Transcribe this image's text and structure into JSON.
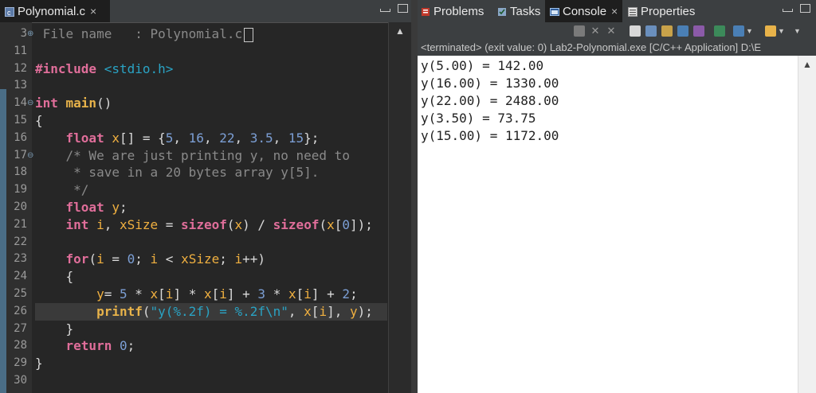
{
  "editor": {
    "tab_label": "Polynomial.c",
    "tab_close": "×",
    "line_numbers": [
      "3",
      "11",
      "12",
      "13",
      "14",
      "15",
      "16",
      "17",
      "18",
      "19",
      "20",
      "21",
      "22",
      "23",
      "24",
      "25",
      "26",
      "27",
      "28",
      "29",
      "30"
    ],
    "fold_markers": {
      "0": "⊕",
      "4": "⊖",
      "7": "⊖"
    },
    "lines": [
      [
        [
          "c-cmt",
          " File name   : Polynomial.c"
        ]
      ],
      [],
      [
        [
          "c-inc",
          "#include "
        ],
        [
          "c-hdr",
          "<stdio.h>"
        ]
      ],
      [],
      [
        [
          "c-kw",
          "int "
        ],
        [
          "c-fn",
          "main"
        ],
        [
          "c-op",
          "()"
        ]
      ],
      [
        [
          "c-op",
          "{"
        ]
      ],
      [
        [
          "c-op",
          "    "
        ],
        [
          "c-kw",
          "float "
        ],
        [
          "c-var",
          "x"
        ],
        [
          "c-op",
          "[] = {"
        ],
        [
          "c-num",
          "5"
        ],
        [
          "c-op",
          ", "
        ],
        [
          "c-num",
          "16"
        ],
        [
          "c-op",
          ", "
        ],
        [
          "c-num",
          "22"
        ],
        [
          "c-op",
          ", "
        ],
        [
          "c-num",
          "3.5"
        ],
        [
          "c-op",
          ", "
        ],
        [
          "c-num",
          "15"
        ],
        [
          "c-op",
          "};"
        ]
      ],
      [
        [
          "c-cmt",
          "    /* We are just printing y, no need to"
        ]
      ],
      [
        [
          "c-cmt",
          "     * save in a 20 bytes array y[5]."
        ]
      ],
      [
        [
          "c-cmt",
          "     */"
        ]
      ],
      [
        [
          "c-op",
          "    "
        ],
        [
          "c-kw",
          "float "
        ],
        [
          "c-var",
          "y"
        ],
        [
          "c-op",
          ";"
        ]
      ],
      [
        [
          "c-op",
          "    "
        ],
        [
          "c-kw",
          "int "
        ],
        [
          "c-var",
          "i"
        ],
        [
          "c-op",
          ", "
        ],
        [
          "c-var",
          "xSize"
        ],
        [
          "c-op",
          " = "
        ],
        [
          "c-kw",
          "sizeof"
        ],
        [
          "c-op",
          "("
        ],
        [
          "c-var",
          "x"
        ],
        [
          "c-op",
          ") / "
        ],
        [
          "c-kw",
          "sizeof"
        ],
        [
          "c-op",
          "("
        ],
        [
          "c-var",
          "x"
        ],
        [
          "c-op",
          "["
        ],
        [
          "c-num",
          "0"
        ],
        [
          "c-op",
          "]);"
        ]
      ],
      [],
      [
        [
          "c-op",
          "    "
        ],
        [
          "c-kw",
          "for"
        ],
        [
          "c-op",
          "("
        ],
        [
          "c-var",
          "i"
        ],
        [
          "c-op",
          " = "
        ],
        [
          "c-num",
          "0"
        ],
        [
          "c-op",
          "; "
        ],
        [
          "c-var",
          "i"
        ],
        [
          "c-op",
          " < "
        ],
        [
          "c-var",
          "xSize"
        ],
        [
          "c-op",
          "; "
        ],
        [
          "c-var",
          "i"
        ],
        [
          "c-op",
          "++)"
        ]
      ],
      [
        [
          "c-op",
          "    {"
        ]
      ],
      [
        [
          "c-op",
          "        "
        ],
        [
          "c-var",
          "y"
        ],
        [
          "c-op",
          "= "
        ],
        [
          "c-num",
          "5"
        ],
        [
          "c-op",
          " * "
        ],
        [
          "c-var",
          "x"
        ],
        [
          "c-op",
          "["
        ],
        [
          "c-var",
          "i"
        ],
        [
          "c-op",
          "] * "
        ],
        [
          "c-var",
          "x"
        ],
        [
          "c-op",
          "["
        ],
        [
          "c-var",
          "i"
        ],
        [
          "c-op",
          "] + "
        ],
        [
          "c-num",
          "3"
        ],
        [
          "c-op",
          " * "
        ],
        [
          "c-var",
          "x"
        ],
        [
          "c-op",
          "["
        ],
        [
          "c-var",
          "i"
        ],
        [
          "c-op",
          "] + "
        ],
        [
          "c-num",
          "2"
        ],
        [
          "c-op",
          ";"
        ]
      ],
      [
        [
          "c-op",
          "        "
        ],
        [
          "c-fn",
          "printf"
        ],
        [
          "c-op",
          "("
        ],
        [
          "c-str",
          "\"y(%.2f) = %.2f\\n\""
        ],
        [
          "c-op",
          ", "
        ],
        [
          "c-var",
          "x"
        ],
        [
          "c-op",
          "["
        ],
        [
          "c-var",
          "i"
        ],
        [
          "c-op",
          "], "
        ],
        [
          "c-var",
          "y"
        ],
        [
          "c-op",
          ");"
        ]
      ],
      [
        [
          "c-op",
          "    }"
        ]
      ],
      [
        [
          "c-op",
          "    "
        ],
        [
          "c-kw",
          "return "
        ],
        [
          "c-num",
          "0"
        ],
        [
          "c-op",
          ";"
        ]
      ],
      [
        [
          "c-op",
          "}"
        ]
      ],
      []
    ],
    "current_line_index": 16
  },
  "console_view": {
    "tabs": [
      {
        "label": "Problems",
        "icon": "problems-icon"
      },
      {
        "label": "Tasks",
        "icon": "tasks-icon"
      },
      {
        "label": "Console",
        "icon": "console-icon",
        "close": "×"
      },
      {
        "label": "Properties",
        "icon": "properties-icon"
      }
    ],
    "status": "<terminated> (exit value: 0) Lab2-Polynomial.exe [C/C++ Application] D:\\E",
    "output_lines": [
      "y(5.00) = 142.00",
      "y(16.00) = 1330.00",
      "y(22.00) = 2488.00",
      "y(3.50) = 73.75",
      "y(15.00) = 1172.00"
    ]
  },
  "colors": {
    "ruler": "#4a6d86",
    "accent": "#2aa3c4"
  }
}
